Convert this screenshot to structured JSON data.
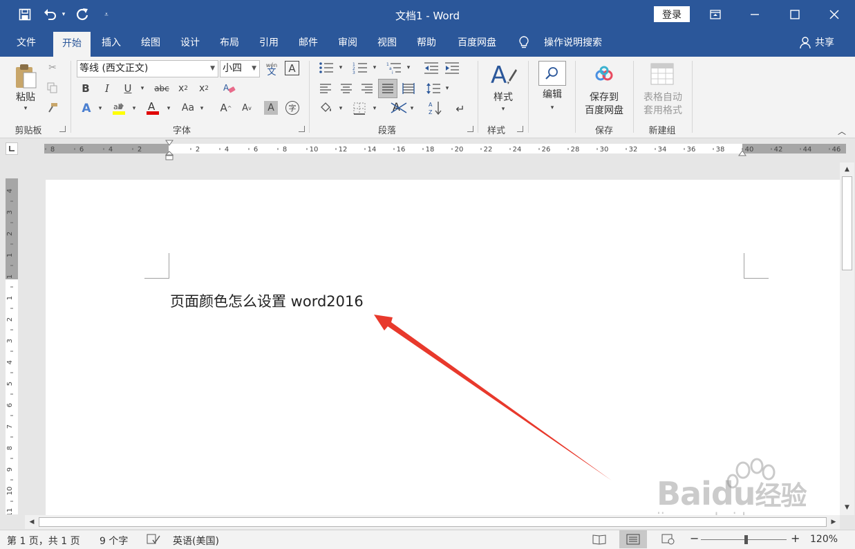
{
  "window": {
    "title": "文档1  -  Word",
    "login_label": "登录"
  },
  "tabs": [
    "文件",
    "开始",
    "插入",
    "绘图",
    "设计",
    "布局",
    "引用",
    "邮件",
    "审阅",
    "视图",
    "帮助",
    "百度网盘"
  ],
  "tell_me": "操作说明搜索",
  "share_label": "共享",
  "ribbon": {
    "clipboard": {
      "paste_label": "粘贴",
      "group_label": "剪贴板"
    },
    "font": {
      "font_name": "等线 (西文正文)",
      "font_size": "小四",
      "phonetic": "wén",
      "group_label": "字体"
    },
    "paragraph": {
      "group_label": "段落"
    },
    "styles": {
      "button_label": "样式",
      "group_label": "样式"
    },
    "editing": {
      "button_label": "编辑"
    },
    "save": {
      "button_label_1": "保存到",
      "button_label_2": "百度网盘",
      "group_label": "保存"
    },
    "newgroup": {
      "button_label_1": "表格自动",
      "button_label_2": "套用格式",
      "group_label": "新建组"
    }
  },
  "hruler_labels": [
    "8",
    "6",
    "4",
    "2",
    "2",
    "4",
    "6",
    "8",
    "10",
    "12",
    "14",
    "16",
    "18",
    "20",
    "22",
    "24",
    "26",
    "28",
    "30",
    "32",
    "34",
    "36",
    "38",
    "40",
    "42",
    "44",
    "46"
  ],
  "vruler_labels": [
    "4",
    "3",
    "2",
    "1",
    "1",
    "1",
    "2",
    "3",
    "4",
    "5",
    "6",
    "7",
    "8",
    "9",
    "10",
    "11"
  ],
  "document": {
    "text": "页面颜色怎么设置 word2016"
  },
  "status": {
    "page": "第 1 页，共 1 页",
    "words": "9 个字",
    "language": "英语(美国)",
    "zoom": "120%",
    "zoom_percent": 120
  },
  "watermark": {
    "brand": "Baidu",
    "brand_cn": "经验",
    "url": "jingyan.baidu.com"
  },
  "colors": {
    "accent": "#2b579a",
    "arrow": "#e8392c"
  }
}
